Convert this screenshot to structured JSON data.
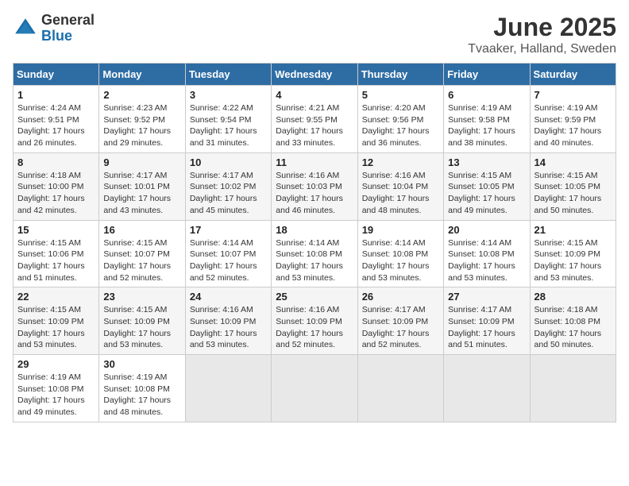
{
  "header": {
    "logo_general": "General",
    "logo_blue": "Blue",
    "month_year": "June 2025",
    "location": "Tvaaker, Halland, Sweden"
  },
  "weekdays": [
    "Sunday",
    "Monday",
    "Tuesday",
    "Wednesday",
    "Thursday",
    "Friday",
    "Saturday"
  ],
  "weeks": [
    [
      {
        "day": "1",
        "sunrise": "4:24 AM",
        "sunset": "9:51 PM",
        "daylight": "Daylight: 17 hours and 26 minutes."
      },
      {
        "day": "2",
        "sunrise": "4:23 AM",
        "sunset": "9:52 PM",
        "daylight": "Daylight: 17 hours and 29 minutes."
      },
      {
        "day": "3",
        "sunrise": "4:22 AM",
        "sunset": "9:54 PM",
        "daylight": "Daylight: 17 hours and 31 minutes."
      },
      {
        "day": "4",
        "sunrise": "4:21 AM",
        "sunset": "9:55 PM",
        "daylight": "Daylight: 17 hours and 33 minutes."
      },
      {
        "day": "5",
        "sunrise": "4:20 AM",
        "sunset": "9:56 PM",
        "daylight": "Daylight: 17 hours and 36 minutes."
      },
      {
        "day": "6",
        "sunrise": "4:19 AM",
        "sunset": "9:58 PM",
        "daylight": "Daylight: 17 hours and 38 minutes."
      },
      {
        "day": "7",
        "sunrise": "4:19 AM",
        "sunset": "9:59 PM",
        "daylight": "Daylight: 17 hours and 40 minutes."
      }
    ],
    [
      {
        "day": "8",
        "sunrise": "4:18 AM",
        "sunset": "10:00 PM",
        "daylight": "Daylight: 17 hours and 42 minutes."
      },
      {
        "day": "9",
        "sunrise": "4:17 AM",
        "sunset": "10:01 PM",
        "daylight": "Daylight: 17 hours and 43 minutes."
      },
      {
        "day": "10",
        "sunrise": "4:17 AM",
        "sunset": "10:02 PM",
        "daylight": "Daylight: 17 hours and 45 minutes."
      },
      {
        "day": "11",
        "sunrise": "4:16 AM",
        "sunset": "10:03 PM",
        "daylight": "Daylight: 17 hours and 46 minutes."
      },
      {
        "day": "12",
        "sunrise": "4:16 AM",
        "sunset": "10:04 PM",
        "daylight": "Daylight: 17 hours and 48 minutes."
      },
      {
        "day": "13",
        "sunrise": "4:15 AM",
        "sunset": "10:05 PM",
        "daylight": "Daylight: 17 hours and 49 minutes."
      },
      {
        "day": "14",
        "sunrise": "4:15 AM",
        "sunset": "10:05 PM",
        "daylight": "Daylight: 17 hours and 50 minutes."
      }
    ],
    [
      {
        "day": "15",
        "sunrise": "4:15 AM",
        "sunset": "10:06 PM",
        "daylight": "Daylight: 17 hours and 51 minutes."
      },
      {
        "day": "16",
        "sunrise": "4:15 AM",
        "sunset": "10:07 PM",
        "daylight": "Daylight: 17 hours and 52 minutes."
      },
      {
        "day": "17",
        "sunrise": "4:14 AM",
        "sunset": "10:07 PM",
        "daylight": "Daylight: 17 hours and 52 minutes."
      },
      {
        "day": "18",
        "sunrise": "4:14 AM",
        "sunset": "10:08 PM",
        "daylight": "Daylight: 17 hours and 53 minutes."
      },
      {
        "day": "19",
        "sunrise": "4:14 AM",
        "sunset": "10:08 PM",
        "daylight": "Daylight: 17 hours and 53 minutes."
      },
      {
        "day": "20",
        "sunrise": "4:14 AM",
        "sunset": "10:08 PM",
        "daylight": "Daylight: 17 hours and 53 minutes."
      },
      {
        "day": "21",
        "sunrise": "4:15 AM",
        "sunset": "10:09 PM",
        "daylight": "Daylight: 17 hours and 53 minutes."
      }
    ],
    [
      {
        "day": "22",
        "sunrise": "4:15 AM",
        "sunset": "10:09 PM",
        "daylight": "Daylight: 17 hours and 53 minutes."
      },
      {
        "day": "23",
        "sunrise": "4:15 AM",
        "sunset": "10:09 PM",
        "daylight": "Daylight: 17 hours and 53 minutes."
      },
      {
        "day": "24",
        "sunrise": "4:16 AM",
        "sunset": "10:09 PM",
        "daylight": "Daylight: 17 hours and 53 minutes."
      },
      {
        "day": "25",
        "sunrise": "4:16 AM",
        "sunset": "10:09 PM",
        "daylight": "Daylight: 17 hours and 52 minutes."
      },
      {
        "day": "26",
        "sunrise": "4:17 AM",
        "sunset": "10:09 PM",
        "daylight": "Daylight: 17 hours and 52 minutes."
      },
      {
        "day": "27",
        "sunrise": "4:17 AM",
        "sunset": "10:09 PM",
        "daylight": "Daylight: 17 hours and 51 minutes."
      },
      {
        "day": "28",
        "sunrise": "4:18 AM",
        "sunset": "10:08 PM",
        "daylight": "Daylight: 17 hours and 50 minutes."
      }
    ],
    [
      {
        "day": "29",
        "sunrise": "4:19 AM",
        "sunset": "10:08 PM",
        "daylight": "Daylight: 17 hours and 49 minutes."
      },
      {
        "day": "30",
        "sunrise": "4:19 AM",
        "sunset": "10:08 PM",
        "daylight": "Daylight: 17 hours and 48 minutes."
      },
      null,
      null,
      null,
      null,
      null
    ]
  ]
}
